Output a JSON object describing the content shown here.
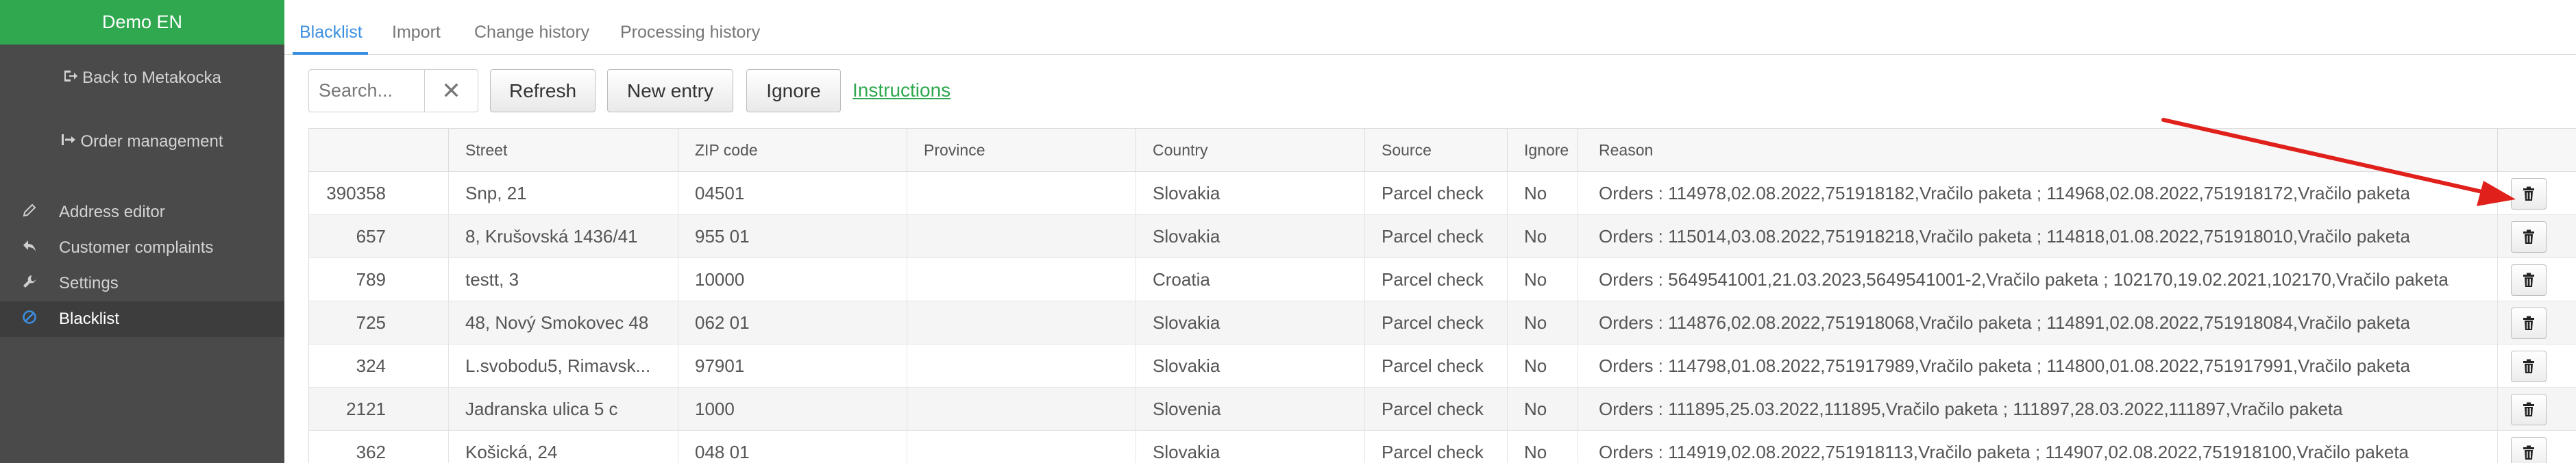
{
  "sidebar": {
    "brand": "Demo EN",
    "back_link": "Back to Metakocka",
    "order_link": "Order management",
    "items": [
      {
        "label": "Address editor",
        "icon": "pencil-icon"
      },
      {
        "label": "Customer complaints",
        "icon": "reply-icon"
      },
      {
        "label": "Settings",
        "icon": "wrench-icon"
      },
      {
        "label": "Blacklist",
        "icon": "ban-icon"
      }
    ]
  },
  "tabs": [
    "Blacklist",
    "Import",
    "Change history",
    "Processing history"
  ],
  "toolbar": {
    "search_placeholder": "Search...",
    "refresh": "Refresh",
    "new_entry": "New entry",
    "ignore": "Ignore",
    "instructions": "Instructions"
  },
  "table": {
    "columns": [
      "",
      "Street",
      "ZIP code",
      "Province",
      "Country",
      "Source",
      "Ignore",
      "Reason",
      ""
    ],
    "rows": [
      [
        "390358",
        "Snp, 21",
        "04501",
        "",
        "Slovakia",
        "Parcel check",
        "No",
        "Orders : 114978,02.08.2022,751918182,Vračilo paketa ; 114968,02.08.2022,751918172,Vračilo paketa"
      ],
      [
        "657",
        "8, Krušovská 1436/41",
        "955 01",
        "",
        "Slovakia",
        "Parcel check",
        "No",
        "Orders : 115014,03.08.2022,751918218,Vračilo paketa ; 114818,01.08.2022,751918010,Vračilo paketa"
      ],
      [
        "789",
        "testt, 3",
        "10000",
        "",
        "Croatia",
        "Parcel check",
        "No",
        "Orders : 5649541001,21.03.2023,5649541001-2,Vračilo paketa ; 102170,19.02.2021,102170,Vračilo paketa"
      ],
      [
        "725",
        "48, Nový Smokovec 48",
        "062 01",
        "",
        "Slovakia",
        "Parcel check",
        "No",
        "Orders : 114876,02.08.2022,751918068,Vračilo paketa ; 114891,02.08.2022,751918084,Vračilo paketa"
      ],
      [
        "324",
        "L.svobodu5, Rimavsk...",
        "97901",
        "",
        "Slovakia",
        "Parcel check",
        "No",
        "Orders : 114798,01.08.2022,751917989,Vračilo paketa ; 114800,01.08.2022,751917991,Vračilo paketa"
      ],
      [
        "2121",
        "Jadranska ulica 5 c",
        "1000",
        "",
        "Slovenia",
        "Parcel check",
        "No",
        "Orders : 111895,25.03.2022,111895,Vračilo paketa ; 111897,28.03.2022,111897,Vračilo paketa"
      ],
      [
        "362",
        "Košická, 24",
        "048 01",
        "",
        "Slovakia",
        "Parcel check",
        "No",
        "Orders : 114919,02.08.2022,751918113,Vračilo paketa ; 114907,02.08.2022,751918100,Vračilo paketa"
      ]
    ]
  },
  "colors": {
    "brand_green": "#2fa84f",
    "sidebar_bg": "#4a4a4a",
    "accent_blue": "#3b8fe0",
    "arrow_red": "#e0201a"
  }
}
